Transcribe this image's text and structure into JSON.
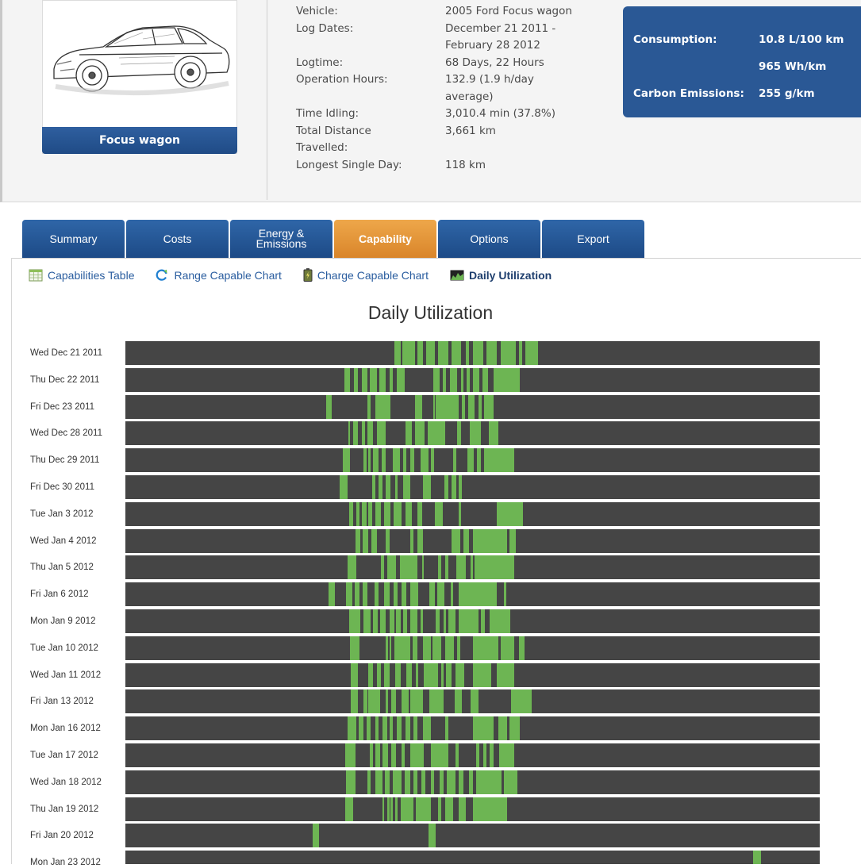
{
  "vehicle_card": {
    "name": "Focus wagon",
    "image_alt": "sedan car sketch"
  },
  "vehicle_info": [
    {
      "label": "Vehicle:",
      "value": "2005 Ford Focus wagon"
    },
    {
      "label": "Log Dates:",
      "value": "December 21 2011 -"
    },
    {
      "label": "",
      "value": "February 28 2012"
    },
    {
      "label": "Logtime:",
      "value": "68 Days, 22 Hours"
    },
    {
      "label": "Operation Hours:",
      "value": "132.9 (1.9 h/day"
    },
    {
      "label": "",
      "value": "average)"
    },
    {
      "label": "Time Idling:",
      "value": "3,010.4 min (37.8%)"
    },
    {
      "label": "Total Distance",
      "value": "3,661 km"
    },
    {
      "label": "Travelled:",
      "value": ""
    },
    {
      "label": "Longest Single Day:",
      "value": "118 km"
    }
  ],
  "stats": {
    "consumption_label": "Consumption:",
    "consumption_value": "10.8 L/100 km",
    "energy_value": "965 Wh/km",
    "emissions_label": "Carbon Emissions:",
    "emissions_value": "255 g/km"
  },
  "tabs": [
    {
      "label": "Summary",
      "active": false
    },
    {
      "label": "Costs",
      "active": false
    },
    {
      "label": "Energy &\nEmissions",
      "active": false
    },
    {
      "label": "Capability",
      "active": true
    },
    {
      "label": "Options",
      "active": false
    },
    {
      "label": "Export",
      "active": false
    }
  ],
  "subnav": [
    {
      "label": "Capabilities Table",
      "icon": "table-icon",
      "active": false
    },
    {
      "label": "Range Capable Chart",
      "icon": "refresh-icon",
      "active": false
    },
    {
      "label": "Charge Capable Chart",
      "icon": "battery-icon",
      "active": false
    },
    {
      "label": "Daily Utilization",
      "icon": "area-chart-icon",
      "active": true
    }
  ],
  "colors": {
    "bar_idle": "#454545",
    "bar_active": "#6db553",
    "tab": "#2a5895",
    "tab_active": "#e3933a"
  },
  "chart_data": {
    "type": "heatmap",
    "title": "Daily Utilization",
    "x_unit": "fraction of day",
    "rows": [
      {
        "label": "Wed Dec 21 2011",
        "segments": [
          [
            0.387,
            0.396
          ],
          [
            0.399,
            0.417
          ],
          [
            0.421,
            0.428
          ],
          [
            0.433,
            0.446
          ],
          [
            0.45,
            0.465
          ],
          [
            0.47,
            0.483
          ],
          [
            0.49,
            0.495
          ],
          [
            0.5,
            0.515
          ],
          [
            0.52,
            0.535
          ],
          [
            0.54,
            0.562
          ],
          [
            0.567,
            0.571
          ],
          [
            0.576,
            0.583
          ],
          [
            0.58,
            0.594
          ]
        ]
      },
      {
        "label": "Thu Dec 22 2011",
        "segments": [
          [
            0.315,
            0.323
          ],
          [
            0.329,
            0.335
          ],
          [
            0.34,
            0.348
          ],
          [
            0.352,
            0.362
          ],
          [
            0.366,
            0.375
          ],
          [
            0.381,
            0.385
          ],
          [
            0.391,
            0.402
          ],
          [
            0.443,
            0.453
          ],
          [
            0.457,
            0.462
          ],
          [
            0.467,
            0.478
          ],
          [
            0.483,
            0.487
          ],
          [
            0.491,
            0.496
          ],
          [
            0.5,
            0.51
          ],
          [
            0.514,
            0.522
          ],
          [
            0.53,
            0.568
          ]
        ]
      },
      {
        "label": "Fri Dec 23 2011",
        "segments": [
          [
            0.289,
            0.297
          ],
          [
            0.349,
            0.353
          ],
          [
            0.36,
            0.382
          ],
          [
            0.417,
            0.427
          ],
          [
            0.443,
            0.446
          ],
          [
            0.447,
            0.48
          ],
          [
            0.485,
            0.489
          ],
          [
            0.494,
            0.503
          ],
          [
            0.508,
            0.513
          ],
          [
            0.517,
            0.53
          ]
        ]
      },
      {
        "label": "Wed Dec 28 2011",
        "segments": [
          [
            0.321,
            0.323
          ],
          [
            0.328,
            0.335
          ],
          [
            0.34,
            0.345
          ],
          [
            0.349,
            0.357
          ],
          [
            0.362,
            0.375
          ],
          [
            0.403,
            0.413
          ],
          [
            0.417,
            0.431
          ],
          [
            0.435,
            0.46
          ],
          [
            0.478,
            0.483
          ],
          [
            0.496,
            0.512
          ],
          [
            0.523,
            0.537
          ]
        ]
      },
      {
        "label": "Thu Dec 29 2011",
        "segments": [
          [
            0.313,
            0.323
          ],
          [
            0.343,
            0.347
          ],
          [
            0.35,
            0.353
          ],
          [
            0.357,
            0.365
          ],
          [
            0.369,
            0.375
          ],
          [
            0.385,
            0.395
          ],
          [
            0.4,
            0.405
          ],
          [
            0.41,
            0.416
          ],
          [
            0.425,
            0.437
          ],
          [
            0.44,
            0.445
          ],
          [
            0.472,
            0.477
          ],
          [
            0.493,
            0.502
          ],
          [
            0.506,
            0.512
          ],
          [
            0.516,
            0.56
          ]
        ]
      },
      {
        "label": "Fri Dec 30 2011",
        "segments": [
          [
            0.308,
            0.32
          ],
          [
            0.355,
            0.36
          ],
          [
            0.365,
            0.37
          ],
          [
            0.375,
            0.382
          ],
          [
            0.388,
            0.392
          ],
          [
            0.4,
            0.41
          ],
          [
            0.428,
            0.44
          ],
          [
            0.459,
            0.465
          ],
          [
            0.47,
            0.477
          ],
          [
            0.48,
            0.485
          ]
        ]
      },
      {
        "label": "Tue Jan 3 2012",
        "segments": [
          [
            0.322,
            0.328
          ],
          [
            0.332,
            0.337
          ],
          [
            0.341,
            0.347
          ],
          [
            0.35,
            0.355
          ],
          [
            0.36,
            0.368
          ],
          [
            0.372,
            0.382
          ],
          [
            0.386,
            0.398
          ],
          [
            0.403,
            0.413
          ],
          [
            0.42,
            0.427
          ],
          [
            0.446,
            0.457
          ],
          [
            0.48,
            0.483
          ],
          [
            0.535,
            0.573
          ]
        ]
      },
      {
        "label": "Wed Jan 4 2012",
        "segments": [
          [
            0.331,
            0.338
          ],
          [
            0.342,
            0.35
          ],
          [
            0.354,
            0.362
          ],
          [
            0.375,
            0.381
          ],
          [
            0.41,
            0.415
          ],
          [
            0.42,
            0.428
          ],
          [
            0.47,
            0.482
          ],
          [
            0.487,
            0.495
          ],
          [
            0.5,
            0.55
          ],
          [
            0.553,
            0.562
          ]
        ]
      },
      {
        "label": "Thu Jan 5 2012",
        "segments": [
          [
            0.32,
            0.333
          ],
          [
            0.368,
            0.372
          ],
          [
            0.377,
            0.39
          ],
          [
            0.395,
            0.41
          ],
          [
            0.41,
            0.42
          ],
          [
            0.427,
            0.428
          ],
          [
            0.45,
            0.455
          ],
          [
            0.46,
            0.465
          ],
          [
            0.477,
            0.49
          ],
          [
            0.497,
            0.5
          ],
          [
            0.503,
            0.56
          ]
        ]
      },
      {
        "label": "Fri Jan 6 2012",
        "segments": [
          [
            0.293,
            0.302
          ],
          [
            0.318,
            0.327
          ],
          [
            0.33,
            0.337
          ],
          [
            0.342,
            0.348
          ],
          [
            0.359,
            0.365
          ],
          [
            0.372,
            0.38
          ],
          [
            0.386,
            0.392
          ],
          [
            0.398,
            0.404
          ],
          [
            0.41,
            0.422
          ],
          [
            0.438,
            0.446
          ],
          [
            0.449,
            0.459
          ],
          [
            0.468,
            0.472
          ],
          [
            0.48,
            0.535
          ],
          [
            0.545,
            0.548
          ]
        ]
      },
      {
        "label": "Mon Jan 9 2012",
        "segments": [
          [
            0.322,
            0.338
          ],
          [
            0.343,
            0.353
          ],
          [
            0.357,
            0.363
          ],
          [
            0.367,
            0.375
          ],
          [
            0.38,
            0.387
          ],
          [
            0.39,
            0.397
          ],
          [
            0.4,
            0.406
          ],
          [
            0.41,
            0.42
          ],
          [
            0.425,
            0.428
          ],
          [
            0.447,
            0.453
          ],
          [
            0.458,
            0.462
          ],
          [
            0.465,
            0.475
          ],
          [
            0.48,
            0.508
          ],
          [
            0.512,
            0.518
          ],
          [
            0.524,
            0.554
          ]
        ]
      },
      {
        "label": "Tue Jan 10 2012",
        "segments": [
          [
            0.323,
            0.337
          ],
          [
            0.375,
            0.378
          ],
          [
            0.38,
            0.383
          ],
          [
            0.387,
            0.41
          ],
          [
            0.414,
            0.42
          ],
          [
            0.428,
            0.44
          ],
          [
            0.442,
            0.455
          ],
          [
            0.46,
            0.473
          ],
          [
            0.478,
            0.482
          ],
          [
            0.5,
            0.537
          ],
          [
            0.541,
            0.56
          ],
          [
            0.567,
            0.575
          ]
        ]
      },
      {
        "label": "Wed Jan 11 2012",
        "segments": [
          [
            0.325,
            0.335
          ],
          [
            0.35,
            0.357
          ],
          [
            0.362,
            0.368
          ],
          [
            0.372,
            0.38
          ],
          [
            0.388,
            0.397
          ],
          [
            0.404,
            0.412
          ],
          [
            0.418,
            0.422
          ],
          [
            0.43,
            0.45
          ],
          [
            0.455,
            0.458
          ],
          [
            0.462,
            0.47
          ],
          [
            0.475,
            0.488
          ],
          [
            0.5,
            0.527
          ],
          [
            0.535,
            0.56
          ]
        ]
      },
      {
        "label": "Fri Jan 13 2012",
        "segments": [
          [
            0.325,
            0.335
          ],
          [
            0.343,
            0.348
          ],
          [
            0.35,
            0.367
          ],
          [
            0.375,
            0.378
          ],
          [
            0.383,
            0.39
          ],
          [
            0.398,
            0.408
          ],
          [
            0.41,
            0.428
          ],
          [
            0.438,
            0.458
          ],
          [
            0.474,
            0.485
          ],
          [
            0.497,
            0.508
          ],
          [
            0.555,
            0.585
          ]
        ]
      },
      {
        "label": "Mon Jan 16 2012",
        "segments": [
          [
            0.32,
            0.332
          ],
          [
            0.336,
            0.343
          ],
          [
            0.347,
            0.353
          ],
          [
            0.36,
            0.365
          ],
          [
            0.37,
            0.377
          ],
          [
            0.381,
            0.385
          ],
          [
            0.391,
            0.398
          ],
          [
            0.403,
            0.41
          ],
          [
            0.415,
            0.42
          ],
          [
            0.428,
            0.44
          ],
          [
            0.46,
            0.465
          ],
          [
            0.5,
            0.53
          ],
          [
            0.537,
            0.55
          ],
          [
            0.553,
            0.568
          ]
        ]
      },
      {
        "label": "Tue Jan 17 2012",
        "segments": [
          [
            0.317,
            0.331
          ],
          [
            0.352,
            0.357
          ],
          [
            0.36,
            0.367
          ],
          [
            0.37,
            0.378
          ],
          [
            0.383,
            0.39
          ],
          [
            0.398,
            0.402
          ],
          [
            0.41,
            0.43
          ],
          [
            0.44,
            0.465
          ],
          [
            0.475,
            0.48
          ],
          [
            0.505,
            0.51
          ],
          [
            0.515,
            0.52
          ],
          [
            0.525,
            0.53
          ],
          [
            0.538,
            0.56
          ]
        ]
      },
      {
        "label": "Wed Jan 18 2012",
        "segments": [
          [
            0.318,
            0.331
          ],
          [
            0.348,
            0.353
          ],
          [
            0.36,
            0.37
          ],
          [
            0.374,
            0.38
          ],
          [
            0.385,
            0.398
          ],
          [
            0.402,
            0.41
          ],
          [
            0.415,
            0.42
          ],
          [
            0.426,
            0.432
          ],
          [
            0.44,
            0.445
          ],
          [
            0.452,
            0.458
          ],
          [
            0.463,
            0.475
          ],
          [
            0.48,
            0.487
          ],
          [
            0.495,
            0.5
          ],
          [
            0.505,
            0.542
          ],
          [
            0.545,
            0.565
          ]
        ]
      },
      {
        "label": "Thu Jan 19 2012",
        "segments": [
          [
            0.317,
            0.328
          ],
          [
            0.37,
            0.373
          ],
          [
            0.377,
            0.38
          ],
          [
            0.382,
            0.385
          ],
          [
            0.388,
            0.392
          ],
          [
            0.396,
            0.415
          ],
          [
            0.418,
            0.44
          ],
          [
            0.45,
            0.455
          ],
          [
            0.46,
            0.472
          ],
          [
            0.48,
            0.49
          ],
          [
            0.5,
            0.55
          ]
        ]
      },
      {
        "label": "Fri Jan 20 2012",
        "segments": [
          [
            0.27,
            0.279
          ],
          [
            0.437,
            0.447
          ]
        ]
      },
      {
        "label": "Mon Jan 23 2012",
        "segments": [
          [
            0.904,
            0.915
          ]
        ]
      }
    ]
  }
}
